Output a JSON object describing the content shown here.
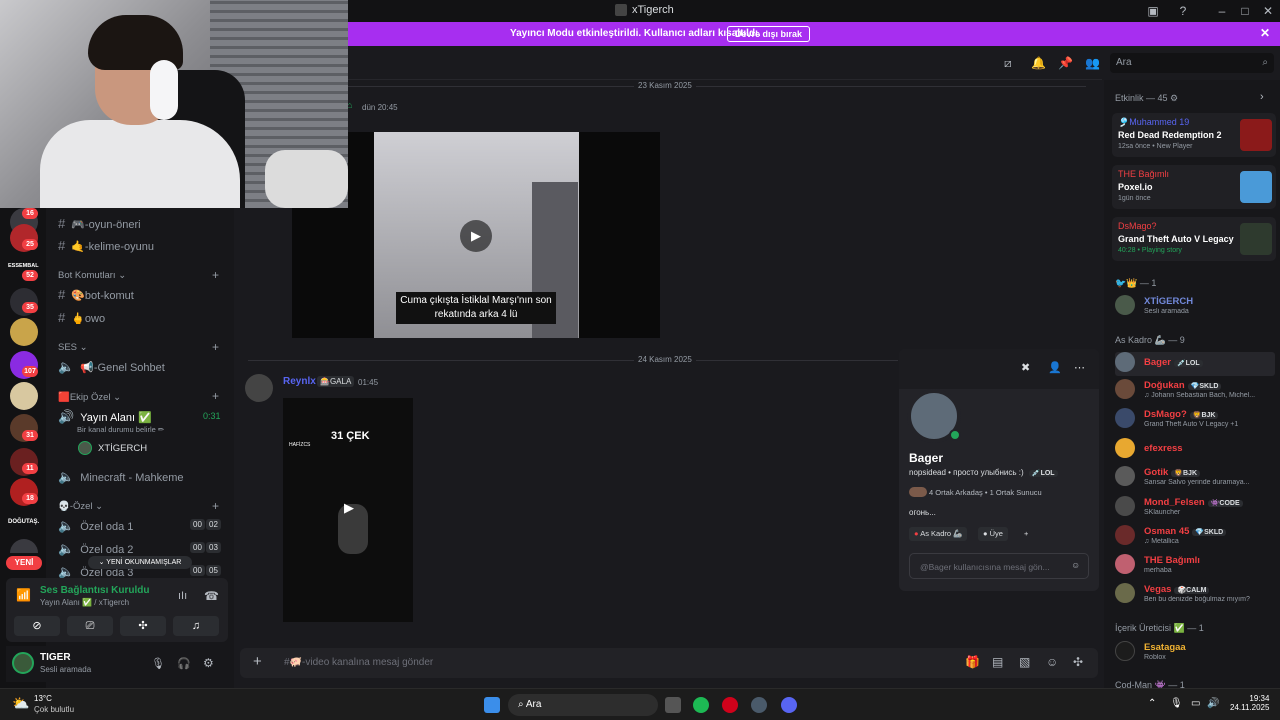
{
  "window": {
    "title": "xTigerch"
  },
  "banner": {
    "text": "Yayıncı Modu etkinleştirildi. Kullanıcı adları kısaltıldı.",
    "button": "Devre dışı bırak"
  },
  "rail": {
    "badges": [
      "16",
      "25",
      "52",
      "35",
      "107",
      "31",
      "11",
      "18"
    ],
    "labels": [
      "ESSEMBAL",
      "DOĞUTAŞ."
    ],
    "new_label": "YENİ"
  },
  "channels": {
    "items": [
      {
        "label": "🎮-oyun-öneri"
      },
      {
        "label": "🤙-kelime-oyunu"
      },
      {
        "label": "🎨bot-komut"
      },
      {
        "label": "🖕owo"
      },
      {
        "label": "📢-Genel Sohbet"
      },
      {
        "label": "Yayın Alanı ✅"
      },
      {
        "label": "Minecraft - Mahkeme"
      },
      {
        "label": "Özel oda 1"
      },
      {
        "label": "Özel oda 2"
      },
      {
        "label": "Özel oda 3"
      }
    ],
    "categories": [
      "Bot Komutları ⌄",
      "SES ⌄",
      "🟥Ekip Özel ⌄",
      "💀-Özel ⌄"
    ],
    "yayin_timer": "0:31",
    "yayin_status": "Bir kanal durumu belirle ✏",
    "voice_user": "XTİGERCH",
    "room_counts": [
      [
        "00",
        "02"
      ],
      [
        "00",
        "03"
      ],
      [
        "00",
        "05"
      ]
    ],
    "new_messages": "⌄ YENİ OKUNMAMIŞLAR"
  },
  "voice_panel": {
    "title": "Ses Bağlantısı Kuruldu",
    "subtitle": "Yayın Alanı ✅ / xTigerch"
  },
  "user_panel": {
    "name": "TIGER",
    "status": "Sesli aramada"
  },
  "search": {
    "placeholder": "Ara"
  },
  "chat": {
    "date1": "23 Kasım 2025",
    "msg1_time": "dün 20:45",
    "video1_caption": "Cuma çıkışta İstiklal Marşı'nın son rekatında arka 4 lü",
    "date2": "24 Kasım 2025",
    "msg2_author": "Reynlx",
    "msg2_tag": "🎰GALA",
    "msg2_time": "01:45",
    "video2_title": "31 ÇEK",
    "video2_small": "HAFİZCS",
    "composer_placeholder": "#🐖-video kanalına mesaj gönder"
  },
  "profile": {
    "name": "Bager",
    "bio": "nopsidead • просто улыбнись :)",
    "tag": "💉LOL",
    "mutual": "4 Ortak Arkadaş • 1 Ortak Sunucu",
    "note": "огонь...",
    "roles": [
      "As Kadro 🦾",
      "Üye",
      "+"
    ],
    "message_placeholder": "@Bager kullanıcısına mesaj gön..."
  },
  "activity": {
    "header": "Etkinlik — 45 ⚙",
    "cards": [
      {
        "who": "🎐Muhammed 19",
        "game": "Red Dead Redemption 2",
        "meta": "12sa önce • New Player"
      },
      {
        "who": "THE Bağımlı",
        "game": "Poxel.io",
        "meta": "1gün önce"
      },
      {
        "who": "DsMago?",
        "game": "Grand Theft Auto V Legacy",
        "meta": "40:28 • Playing story"
      }
    ]
  },
  "members": {
    "group1": "🐦👑 — 1",
    "group1_members": [
      {
        "name": "XTİGERCH",
        "status": "Sesli aramada",
        "color": "#7289da"
      }
    ],
    "group2": "As Kadro 🦾 — 9",
    "group2_members": [
      {
        "name": "Bager",
        "tag": "💉LOL",
        "status": "",
        "color": "#f23f43"
      },
      {
        "name": "Doğukan",
        "tag": "💎SKLD",
        "status": "♫ Johann Sebastian Bach, Michel...",
        "color": "#f23f43"
      },
      {
        "name": "DsMago?",
        "tag": "🦁BJK",
        "status": "Grand Theft Auto V Legacy +1",
        "color": "#f23f43"
      },
      {
        "name": "efexress",
        "tag": "",
        "status": "",
        "color": "#f23f43"
      },
      {
        "name": "Gotik",
        "tag": "🦁BJK",
        "status": "Sansar Salvo yerinde duramaya...",
        "color": "#f23f43"
      },
      {
        "name": "Mond_Felsen",
        "tag": "👾CODE",
        "status": "SKlauncher",
        "color": "#f23f43"
      },
      {
        "name": "Osman 45",
        "tag": "💎SKLD",
        "status": "♫ Metallica",
        "color": "#f23f43"
      },
      {
        "name": "THE Bağımlı",
        "tag": "",
        "status": "merhaba",
        "color": "#f23f43"
      },
      {
        "name": "Vegas",
        "tag": "🎲CALM",
        "status": "Ben bu denizde boğulmaz mıyım?",
        "color": "#f23f43"
      }
    ],
    "group3": "İçerik Üreticisi ✅ — 1",
    "group3_members": [
      {
        "name": "Esatagaa",
        "status": "Roblox",
        "color": "#f0b232"
      }
    ],
    "group4": "Cod-Man 👾 — 1"
  },
  "taskbar": {
    "temp": "13°C",
    "weather": "Çok bulutlu",
    "search": "Ara",
    "time": "19:34",
    "date": "24.11.2025"
  }
}
